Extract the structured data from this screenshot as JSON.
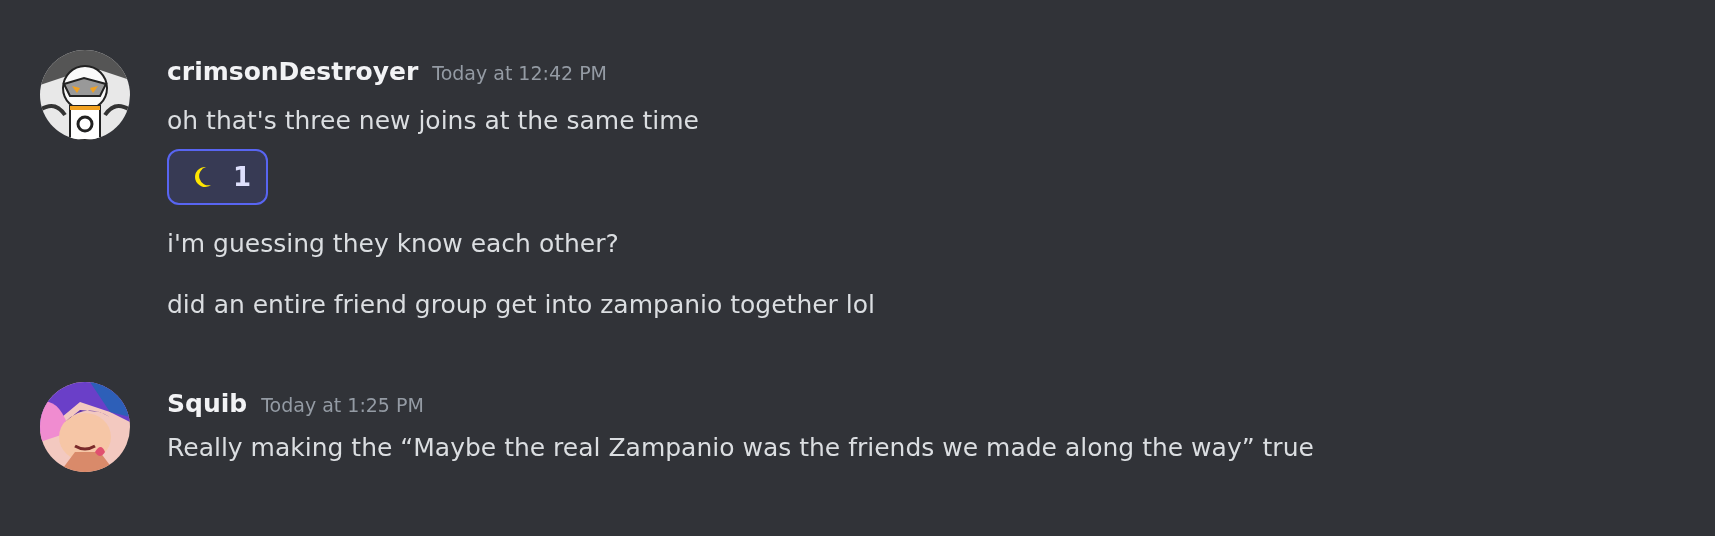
{
  "messages": [
    {
      "author": "crimsonDestroyer",
      "timestamp": "Today at 12:42 PM",
      "lines": [
        {
          "text": "oh that's three new joins at the same time",
          "reactions": [
            {
              "count": "1",
              "selected": true
            }
          ]
        },
        {
          "text": "i'm guessing they know each other?"
        },
        {
          "text": "did an entire friend group get into zampanio together lol"
        }
      ]
    },
    {
      "author": "Squib",
      "timestamp": "Today at 1:25 PM",
      "lines": [
        {
          "text": "Really making the “Maybe the real Zampanio was the friends we made along the way” true"
        }
      ]
    }
  ]
}
